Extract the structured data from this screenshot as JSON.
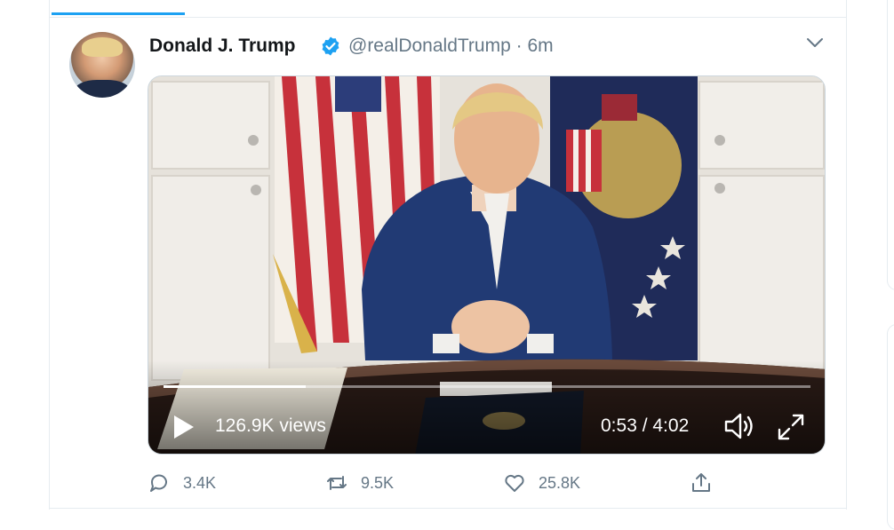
{
  "tweet": {
    "author_name": "Donald J. Trump",
    "handle": "@realDonaldTrump",
    "separator": "·",
    "time": "6m",
    "verified": true,
    "accent_color": "#1da1f2"
  },
  "video": {
    "views": "126.9K views",
    "time_display": "0:53 / 4:02",
    "progress": 0.22,
    "controls": {
      "play_icon": "play-icon",
      "volume_icon": "volume-icon",
      "fullscreen_icon": "fullscreen-icon"
    }
  },
  "actions": {
    "replies": "3.4K",
    "retweets": "9.5K",
    "likes": "25.8K"
  },
  "colors": {
    "secondary_text": "#657786",
    "border": "#e6ecf0"
  }
}
